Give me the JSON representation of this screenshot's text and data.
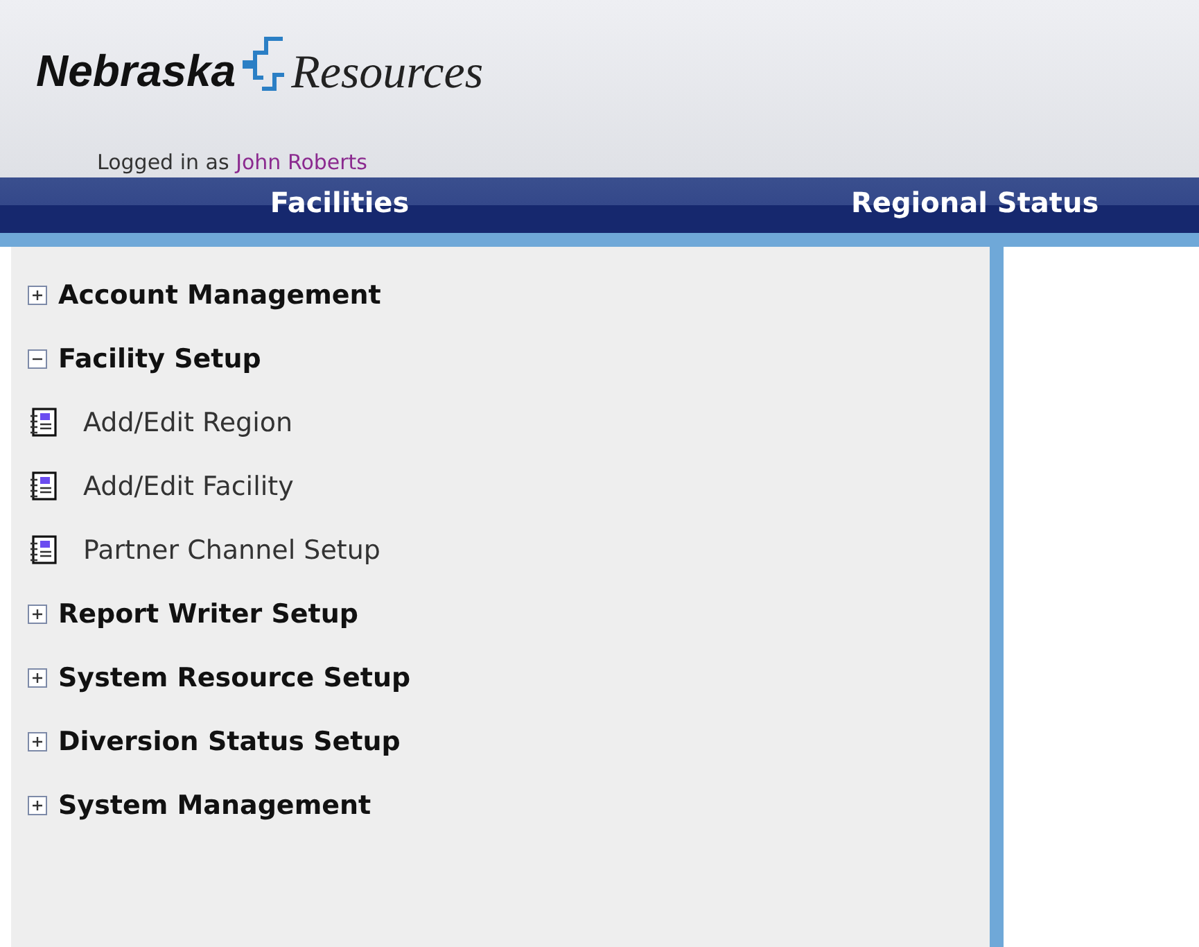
{
  "logo": {
    "word": "Nebraska",
    "sub": "Resources"
  },
  "login": {
    "prefix": "Logged in as",
    "user": "John Roberts"
  },
  "nav": [
    "Facilities",
    "Regional Status"
  ],
  "menu": [
    {
      "label": "Account Management",
      "expanded": false
    },
    {
      "label": "Facility Setup",
      "expanded": true,
      "children": [
        {
          "label": "Add/Edit Region"
        },
        {
          "label": "Add/Edit Facility"
        },
        {
          "label": "Partner Channel Setup"
        }
      ]
    },
    {
      "label": "Report Writer Setup",
      "expanded": false
    },
    {
      "label": "System Resource Setup",
      "expanded": false
    },
    {
      "label": "Diversion Status Setup",
      "expanded": false
    },
    {
      "label": "System Management",
      "expanded": false
    }
  ]
}
